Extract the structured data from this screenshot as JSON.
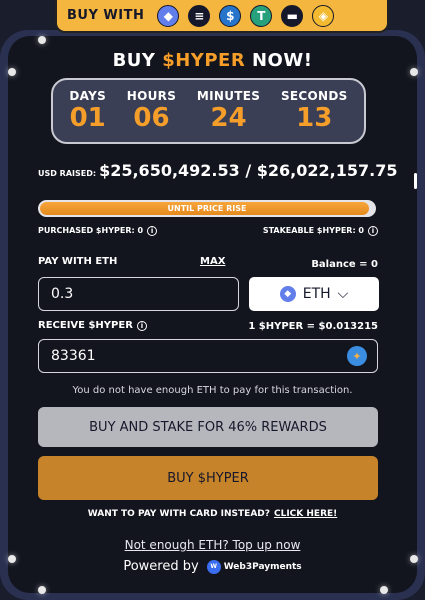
{
  "buy_with": {
    "label": "BUY WITH",
    "coins": [
      {
        "icon": "eth-icon",
        "glyph": "◆",
        "color": "#627eea"
      },
      {
        "icon": "solana-icon",
        "glyph": "≡",
        "color": "#15182a"
      },
      {
        "icon": "usdc-icon",
        "glyph": "$",
        "color": "#2775ca"
      },
      {
        "icon": "tether-icon",
        "glyph": "T",
        "color": "#26a17b"
      },
      {
        "icon": "card-icon",
        "glyph": "▬",
        "color": "#15182a"
      },
      {
        "icon": "bnb-icon",
        "glyph": "◈",
        "color": "#f3ba2f"
      }
    ]
  },
  "title": {
    "prefix": "BUY ",
    "highlight": "$HYPER",
    "suffix": " NOW!"
  },
  "countdown": {
    "days_label": "DAYS",
    "days": "01",
    "hours_label": "HOURS",
    "hours": "06",
    "minutes_label": "MINUTES",
    "minutes": "24",
    "seconds_label": "SECONDS",
    "seconds": "13"
  },
  "raised": {
    "label": "USD RAISED:",
    "value": "$25,650,492.53 / $26,022,157.75"
  },
  "progress": {
    "label": "UNTIL PRICE RISE",
    "fraction": 0.986
  },
  "info": {
    "purchased": "PURCHASED $HYPER: 0",
    "stakeable": "STAKEABLE $HYPER: 0",
    "info_glyph": "i"
  },
  "pay": {
    "label": "PAY WITH ETH",
    "max": "MAX",
    "balance": "Balance = 0",
    "value": "0.3",
    "currency": "ETH",
    "chevron": "⌵"
  },
  "receive": {
    "label": "RECEIVE $HYPER",
    "rate": "1 $HYPER = $0.013215",
    "value": "83361"
  },
  "warning": "You do not have enough ETH to pay for this transaction.",
  "buttons": {
    "stake": "BUY AND STAKE FOR 46% REWARDS",
    "buy": "BUY $HYPER"
  },
  "card": {
    "text": "WANT TO PAY WITH CARD INSTEAD?",
    "link": "CLICK HERE!"
  },
  "topup": "Not enough ETH? Top up now",
  "powered": {
    "text": "Powered by",
    "brand": "Web3Payments",
    "logo_glyph": "W"
  },
  "colors": {
    "accent": "#f59e2a",
    "panel": "#12141e",
    "frame": "#2a3050"
  }
}
